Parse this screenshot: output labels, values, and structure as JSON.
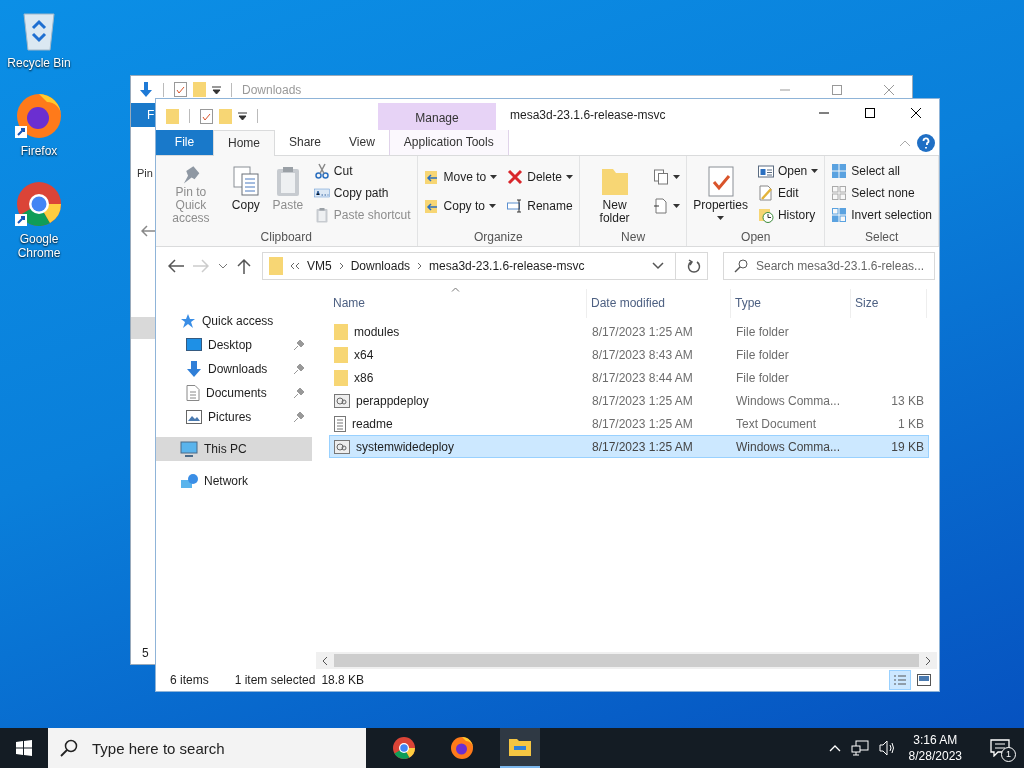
{
  "desktop_icons": [
    {
      "label": "Recycle Bin",
      "kind": "recycle"
    },
    {
      "label": "Firefox",
      "kind": "firefox",
      "shortcut": true
    },
    {
      "label": "Google Chrome",
      "kind": "chrome",
      "shortcut": true
    }
  ],
  "back_window": {
    "title": "Downloads",
    "file_tab": "F",
    "ribbon_text": "Pin",
    "status": "5"
  },
  "window": {
    "title": "mesa3d-23.1.6-release-msvc",
    "context_tab": "Manage",
    "tabs": [
      {
        "label": "File",
        "kind": "file",
        "selected": false
      },
      {
        "label": "Home",
        "kind": "tab",
        "selected": true
      },
      {
        "label": "Share",
        "kind": "tab",
        "selected": false
      },
      {
        "label": "View",
        "kind": "tab",
        "selected": false
      },
      {
        "label": "Application Tools",
        "kind": "context",
        "selected": false
      }
    ],
    "ribbon": [
      {
        "label": "Clipboard",
        "columns": [
          {
            "kind": "large",
            "buttons": [
              {
                "label": "Pin to Quick access",
                "disabled": true,
                "menu": false
              }
            ]
          },
          {
            "kind": "large",
            "buttons": [
              {
                "label": "Copy",
                "disabled": false,
                "menu": false
              }
            ]
          },
          {
            "kind": "large",
            "buttons": [
              {
                "label": "Paste",
                "disabled": true,
                "menu": false
              }
            ]
          },
          {
            "kind": "stack",
            "buttons": [
              {
                "label": "Cut",
                "disabled": false,
                "menu": false
              },
              {
                "label": "Copy path",
                "disabled": false,
                "menu": false
              },
              {
                "label": "Paste shortcut",
                "disabled": true,
                "menu": false
              }
            ]
          }
        ]
      },
      {
        "label": "Organize",
        "columns": [
          {
            "kind": "pair",
            "buttons": [
              {
                "label": "Move to",
                "disabled": false,
                "menu": true
              },
              {
                "label": "Copy to",
                "disabled": false,
                "menu": true
              }
            ]
          },
          {
            "kind": "pair",
            "buttons": [
              {
                "label": "Delete",
                "disabled": false,
                "menu": true
              },
              {
                "label": "Rename",
                "disabled": false,
                "menu": false
              }
            ]
          }
        ]
      },
      {
        "label": "New",
        "columns": [
          {
            "kind": "large",
            "buttons": [
              {
                "label": "New folder",
                "disabled": false,
                "menu": false
              }
            ]
          },
          {
            "kind": "pair",
            "buttons": [
              {
                "menu": true
              },
              {
                "menu": true
              }
            ]
          }
        ]
      },
      {
        "label": "Open",
        "columns": [
          {
            "kind": "large",
            "buttons": [
              {
                "label": "Properties",
                "disabled": false,
                "menu": true
              }
            ]
          },
          {
            "kind": "stack",
            "buttons": [
              {
                "label": "Open",
                "disabled": false,
                "menu": true
              },
              {
                "label": "Edit",
                "disabled": false,
                "menu": false
              },
              {
                "label": "History",
                "disabled": false,
                "menu": false
              }
            ]
          }
        ]
      },
      {
        "label": "Select",
        "columns": [
          {
            "kind": "stack",
            "buttons": [
              {
                "label": "Select all",
                "disabled": false,
                "menu": false
              },
              {
                "label": "Select none",
                "disabled": false,
                "menu": false
              },
              {
                "label": "Invert selection",
                "disabled": false,
                "menu": false
              }
            ]
          }
        ]
      }
    ],
    "address": [
      "VM5",
      "Downloads",
      "mesa3d-23.1.6-release-msvc"
    ],
    "search": {
      "placeholder": "Search mesa3d-23.1.6-releas..."
    },
    "nav": [
      {
        "label": "Quick access",
        "kind": "star",
        "selected": false,
        "children": [
          {
            "label": "Desktop",
            "kind": "desktop",
            "selected": false,
            "pinned": true
          },
          {
            "label": "Downloads",
            "kind": "download",
            "selected": false,
            "pinned": true
          },
          {
            "label": "Documents",
            "kind": "document",
            "selected": false,
            "pinned": true
          },
          {
            "label": "Pictures",
            "kind": "picture",
            "selected": false,
            "pinned": true
          }
        ]
      },
      {
        "label": "This PC",
        "kind": "pc",
        "selected": true
      },
      {
        "label": "Network",
        "kind": "network",
        "selected": false
      }
    ],
    "columns": [
      "Name",
      "Date modified",
      "Type",
      "Size"
    ],
    "rows": [
      {
        "name": "modules",
        "date": "8/17/2023 1:25 AM",
        "type": "File folder",
        "kind": "folder",
        "selected": false
      },
      {
        "name": "x64",
        "date": "8/17/2023 8:43 AM",
        "type": "File folder",
        "kind": "folder",
        "selected": false
      },
      {
        "name": "x86",
        "date": "8/17/2023 8:44 AM",
        "type": "File folder",
        "kind": "folder",
        "selected": false
      },
      {
        "name": "perappdeploy",
        "date": "8/17/2023 1:25 AM",
        "type": "Windows Comma...",
        "size": "13 KB",
        "kind": "script",
        "selected": false
      },
      {
        "name": "readme",
        "date": "8/17/2023 1:25 AM",
        "type": "Text Document",
        "size": "1 KB",
        "kind": "text",
        "selected": false
      },
      {
        "name": "systemwidedeploy",
        "date": "8/17/2023 1:25 AM",
        "type": "Windows Comma...",
        "size": "19 KB",
        "kind": "script",
        "selected": true
      }
    ],
    "status": [
      "6 items",
      "1 item selected",
      "18.8 KB"
    ],
    "views": [
      {
        "kind": "details",
        "selected": true
      },
      {
        "kind": "large",
        "selected": false
      }
    ]
  },
  "taskbar": {
    "search_placeholder": "Type here to search",
    "apps": [
      {
        "kind": "chrome",
        "active": false
      },
      {
        "kind": "firefox",
        "active": false
      },
      {
        "kind": "explorer",
        "active": true
      }
    ],
    "time": "3:16 AM",
    "date": "8/28/2023",
    "notifications": "1"
  }
}
